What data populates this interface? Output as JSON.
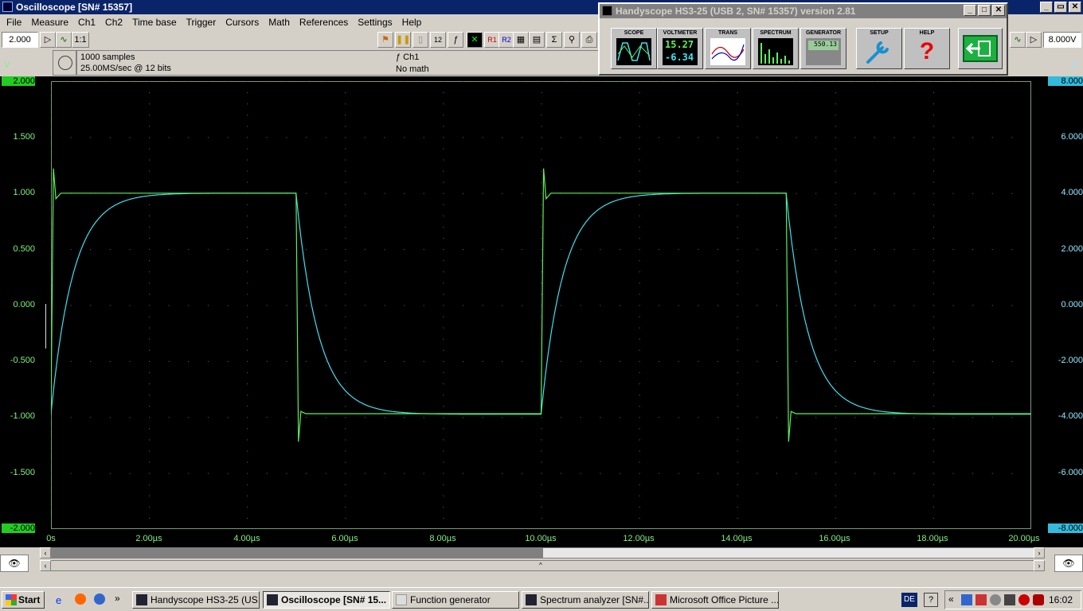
{
  "window": {
    "title": "Oscilloscope  [SN# 15357]",
    "controls": [
      "_",
      "▭",
      "✕"
    ]
  },
  "menu": [
    "File",
    "Measure",
    "Ch1",
    "Ch2",
    "Time base",
    "Trigger",
    "Cursors",
    "Math",
    "References",
    "Settings",
    "Help"
  ],
  "toolbar": {
    "ch1_range": "2.000",
    "probe": "1:1",
    "ch2_range": "8.000V",
    "ref1": "R1",
    "ref2": "R2",
    "twelve": "12"
  },
  "info": {
    "samples": "1000 samples",
    "rate": "25.00MS/sec @ 12 bits",
    "channel": "ƒ Ch1",
    "math": "No math"
  },
  "scope": {
    "left_unit": "V",
    "right_unit": "V",
    "left_ticks": [
      "2.000",
      "1.500",
      "1.000",
      "0.500",
      "0.000",
      "-0.500",
      "-1.000",
      "-1.500",
      "-2.000"
    ],
    "right_ticks": [
      "8.000",
      "6.000",
      "4.000",
      "2.000",
      "0.000",
      "-2.000",
      "-4.000",
      "-6.000",
      "-8.000"
    ],
    "x_ticks": [
      "0s",
      "2.00µs",
      "4.00µs",
      "6.00µs",
      "8.00µs",
      "10.00µs",
      "12.00µs",
      "14.00µs",
      "16.00µs",
      "18.00µs",
      "20.00µs"
    ],
    "colors": {
      "ch1": "#5cf05c",
      "ch2": "#40e0f0",
      "grid": "#5a7a5a"
    }
  },
  "chart_data": {
    "type": "line",
    "xlabel": "",
    "ylabel": "V",
    "xlim": [
      0,
      20
    ],
    "ylim": [
      -2,
      2
    ],
    "ylim_right": [
      -8,
      8
    ],
    "series": [
      {
        "x": [
          0,
          0.05,
          0.1,
          0.2,
          5.0,
          5.05,
          5.1,
          5.2,
          10.0,
          10.05,
          10.1,
          10.2,
          15.0,
          15.05,
          15.1,
          15.2,
          20.0
        ],
        "y": [
          -0.95,
          1.22,
          0.95,
          1.0,
          1.0,
          -1.22,
          -0.95,
          -0.97,
          -0.97,
          1.22,
          0.95,
          1.0,
          1.0,
          -1.22,
          -0.95,
          -0.97,
          -0.97
        ]
      },
      {
        "x": [
          0,
          0.5,
          1.0,
          2.0,
          5.0,
          5.5,
          6.0,
          7.0,
          10.0,
          10.5,
          11.0,
          12.0,
          15.0,
          15.5,
          16.0,
          17.0,
          20.0
        ],
        "y": [
          -3.9,
          2.5,
          3.6,
          3.95,
          4.0,
          -2.5,
          -3.6,
          -3.9,
          -3.9,
          2.5,
          3.6,
          3.95,
          4.0,
          -2.5,
          -3.6,
          -3.9,
          -3.9
        ]
      }
    ]
  },
  "handyscope": {
    "title": "Handyscope HS3-25 (USB 2, SN# 15357) version 2.81",
    "tools": [
      "SCOPE",
      "VOLTMETER",
      "TRANS",
      "SPECTRUM",
      "GENERATOR",
      "SETUP",
      "HELP"
    ],
    "voltmeter_top": "15.27",
    "voltmeter_bottom": "-6.34",
    "generator_value": "550.13"
  },
  "taskbar": {
    "start": "Start",
    "tasks": [
      "Handyscope HS3-25 (US...",
      "Oscilloscope  [SN# 15...",
      "Function generator",
      "Spectrum analyzer  [SN#...",
      "Microsoft Office Picture ..."
    ],
    "lang": "DE",
    "time": "16:02"
  }
}
